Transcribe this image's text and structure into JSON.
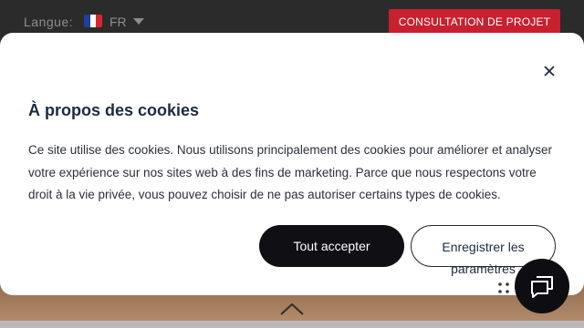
{
  "topbar": {
    "language_label": "Langue:",
    "language_code": "FR",
    "flag_icon": "france-flag-icon",
    "consult_label": "CONSULTATION DE PROJET"
  },
  "cookie_modal": {
    "title": "À propos des cookies",
    "body": "Ce site utilise des cookies. Nous utilisons principalement des cookies pour améliorer et analyser votre expérience sur nos sites web à des fins de marketing. Parce que nous respectons votre droit à la vie privée, vous pouvez choisir de ne pas autoriser certains types de cookies.",
    "accept_label": "Tout accepter",
    "save_label": "Enregistrer les paramètres",
    "close_icon": "close-icon"
  },
  "chat": {
    "icon": "chat-icon"
  },
  "colors": {
    "brand_red": "#c8202e",
    "title_navy": "#1c2b40",
    "button_dark": "#0f0f14"
  }
}
